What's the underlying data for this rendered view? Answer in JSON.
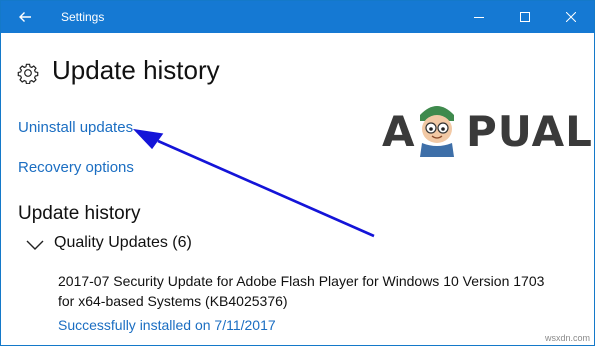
{
  "window": {
    "title": "Settings",
    "colors": {
      "titlebar": "#1579d3",
      "link": "#1b6ec2",
      "arrow": "#1414d8"
    },
    "controls": {
      "back": "arrow-left-icon",
      "minimize": "minimize-icon",
      "maximize": "maximize-icon",
      "close": "close-icon"
    }
  },
  "page": {
    "title": "Update history",
    "icon": "gear-icon",
    "links": {
      "uninstall": "Uninstall updates",
      "recovery": "Recovery options"
    },
    "section_title": "Update history",
    "group": {
      "label": "Quality Updates (6)",
      "icon": "chevron-down-icon",
      "items": [
        {
          "name": "2017-07 Security Update for Adobe Flash Player for Windows 10 Version 1703 for x64-based Systems (KB4025376)",
          "status": "Successfully installed on 7/11/2017"
        }
      ]
    }
  },
  "overlay": {
    "logo_text": "APPUALS",
    "logo_left": "A",
    "logo_right": "PUALS",
    "watermark": "wsxdn.com",
    "arrow_target": "Uninstall updates"
  }
}
